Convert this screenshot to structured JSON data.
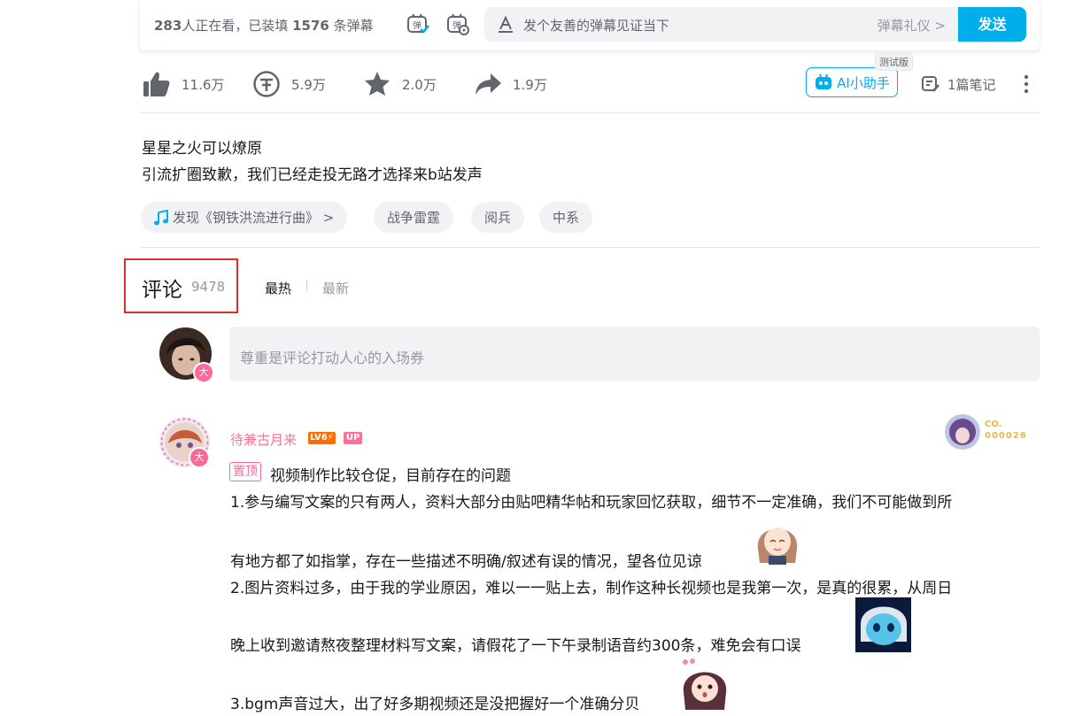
{
  "danmaku": {
    "watching_count": "283",
    "watching_text": "人正在看，已装填",
    "loaded_count": "1576",
    "loaded_text": "条弹幕",
    "input_placeholder": "发个友善的弹幕见证当下",
    "etiquette_label": "弹幕礼仪 >",
    "send_label": "发送",
    "toggle_icon_text": "弹",
    "settings_icon_text": "弹"
  },
  "toolbar": {
    "like_count": "11.6万",
    "coin_count": "5.9万",
    "favorite_count": "2.0万",
    "share_count": "1.9万",
    "ai_label": "AI小助手",
    "ai_tag": "测试版",
    "notes_label": "1篇笔记"
  },
  "description": {
    "line1": "星星之火可以燎原",
    "line2": "引流扩圈致歉，我们已经走投无路才选择来b站发声"
  },
  "tags": [
    {
      "label": "发现《钢铁洪流进行曲》 >"
    },
    {
      "label": "战争雷霆"
    },
    {
      "label": "阅兵"
    },
    {
      "label": "中系"
    }
  ],
  "comments": {
    "title": "评论",
    "count": "9478",
    "sort_hot": "最热",
    "sort_new": "最新",
    "input_placeholder": "尊重是评论打动人心的入场券",
    "badge_text": "大",
    "top_comment": {
      "username": "待兼古月来",
      "level": "LV6⚡",
      "up_badge": "UP",
      "fan_badge_line1": "CO.",
      "fan_badge_line2": "000026",
      "pin_label": "置顶",
      "lines": [
        "视频制作比较仓促，目前存在的问题",
        "1.参与编写文案的只有两人，资料大部分由贴吧精华帖和玩家回忆获取，细节不一定准确，我们不可能做到所",
        "有地方都了如指掌，存在一些描述不明确/叙述有误的情况，望各位见谅",
        "2.图片资料过多，由于我的学业原因，难以一一贴上去，制作这种长视频也是我第一次，是真的很累，从周日",
        "晚上收到邀请熬夜整理材料写文案，请假花了一下午录制语音约300条，难免会有口误",
        "3.bgm声音过大，出了好多期视频还是没把握好一个准确分贝"
      ]
    }
  }
}
